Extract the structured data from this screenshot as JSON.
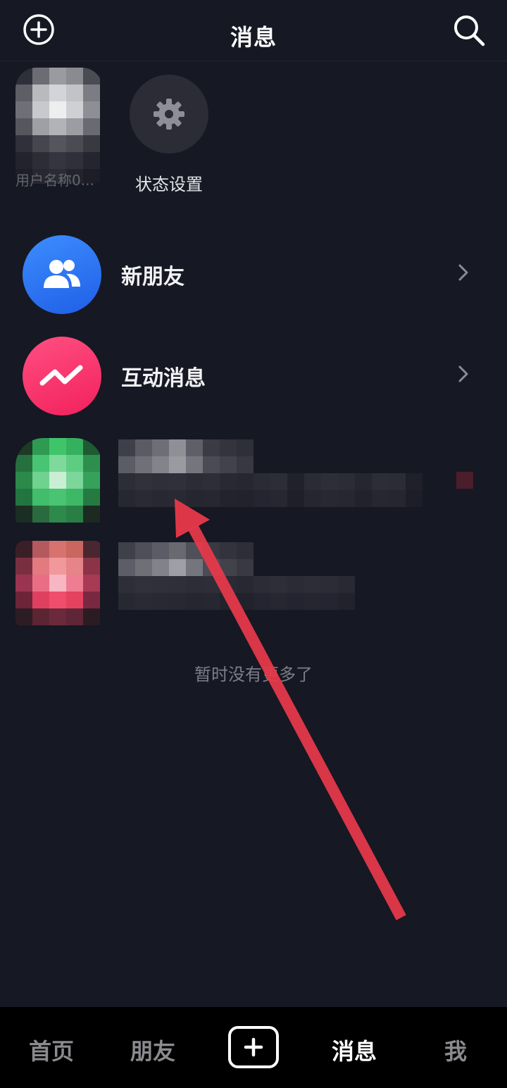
{
  "header": {
    "title": "消息",
    "add_icon": "plus-circle-icon",
    "search_icon": "search-icon"
  },
  "stories": {
    "self_name": "用户名称0...",
    "status_label": "状态设置",
    "status_icon": "gear-icon"
  },
  "entries": [
    {
      "label": "新朋友",
      "icon": "people-icon",
      "color": "#3a7bff"
    },
    {
      "label": "互动消息",
      "icon": "activity-wave-icon",
      "color": "#fb3a6b"
    }
  ],
  "footer_text": "暂时没有更多了",
  "annotation": {
    "color": "#e8394a"
  },
  "tabbar": {
    "tabs": [
      {
        "label": "首页"
      },
      {
        "label": "朋友"
      },
      {
        "label": "消息"
      },
      {
        "label": "我"
      }
    ],
    "plus_icon": "plus-icon",
    "active": "消息"
  }
}
